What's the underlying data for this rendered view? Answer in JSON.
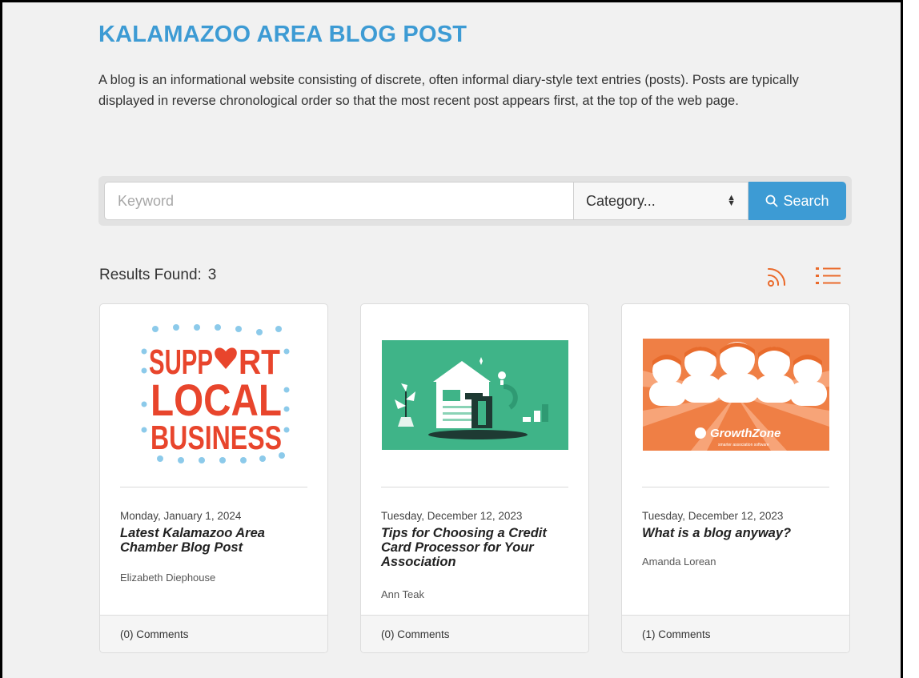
{
  "page": {
    "title": "KALAMAZOO AREA BLOG POST",
    "intro": "A blog is an informational website consisting of discrete, often informal diary-style text entries (posts). Posts are typically displayed in reverse chronological order so that the most recent post appears first, at the top of the web page."
  },
  "search": {
    "keyword_placeholder": "Keyword",
    "keyword_value": "",
    "category_selected": "Category...",
    "button_label": "Search"
  },
  "results": {
    "label": "Results Found:",
    "count": "3"
  },
  "colors": {
    "accent_blue": "#3d9bd4",
    "icon_orange": "#ea6a2b",
    "support_red": "#e8452c",
    "dot_blue": "#8ccaea",
    "teal_bg": "#3fb488",
    "orange_bg": "#ef7f45"
  },
  "posts": [
    {
      "date": "Monday, January 1, 2024",
      "title": "Latest Kalamazoo Area Chamber Blog Post",
      "author": "Elizabeth Diephouse",
      "comments": "(0) Comments",
      "image": {
        "line1": "SUPP",
        "line1b": "RT",
        "line2": "LOCAL",
        "line3": "BUSINESS"
      }
    },
    {
      "date": "Tuesday, December 12, 2023",
      "title": "Tips for Choosing a Credit Card Processor for Your Association",
      "author": "Ann Teak",
      "comments": "(0) Comments"
    },
    {
      "date": "Tuesday, December 12, 2023",
      "title": "What is a blog anyway?",
      "author": "Amanda Lorean",
      "comments": "(1) Comments",
      "image": {
        "brand": "GrowthZone",
        "tagline": "smarter association software"
      }
    }
  ]
}
